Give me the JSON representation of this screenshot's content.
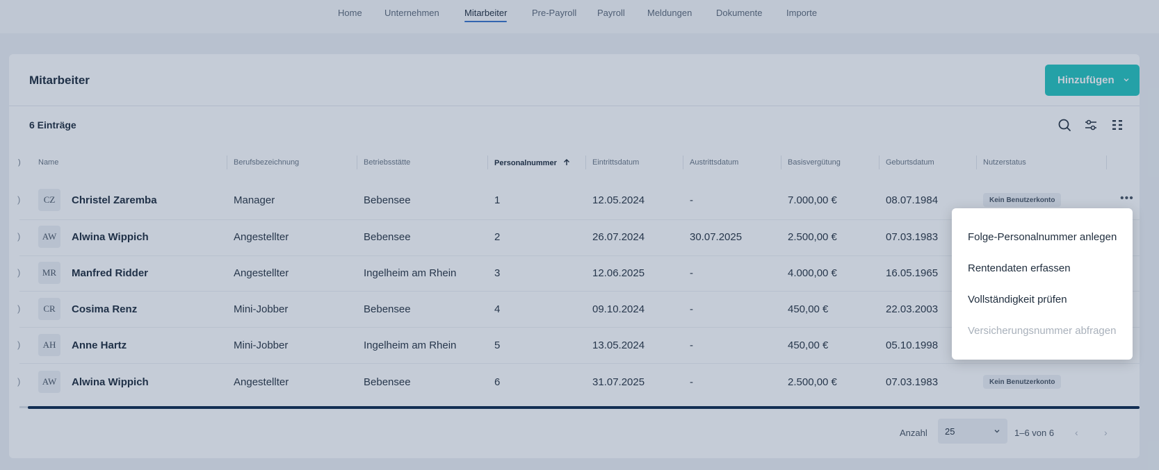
{
  "nav": {
    "tabs": [
      {
        "label": "Home"
      },
      {
        "label": "Unternehmen"
      },
      {
        "label": "Mitarbeiter",
        "active": true
      },
      {
        "label": "Pre-Payroll"
      },
      {
        "label": "Payroll"
      },
      {
        "label": "Meldungen"
      },
      {
        "label": "Dokumente"
      },
      {
        "label": "Importe"
      }
    ]
  },
  "card": {
    "title": "Mitarbeiter",
    "add_label": "Hinzufügen",
    "entries": "6 Einträge",
    "tools": [
      "search-icon",
      "filter-sliders-icon",
      "columns-icon"
    ]
  },
  "table": {
    "columns": [
      "Name",
      "Berufsbezeichnung",
      "Betriebsstätte",
      "Personalnummer",
      "Eintrittsdatum",
      "Austrittsdatum",
      "Basisvergütung",
      "Geburtsdatum",
      "Nutzerstatus"
    ],
    "sorted_column": "Personalnummer",
    "rows": [
      {
        "initials": "CZ",
        "name": "Christel Zaremba",
        "job": "Manager",
        "site": "Bebensee",
        "nr": "1",
        "entry": "12.05.2024",
        "exit": "-",
        "salary": "7.000,00 €",
        "birth": "08.07.1984",
        "status": "Kein Benutzerkonto"
      },
      {
        "initials": "AW",
        "name": "Alwina Wippich",
        "job": "Angestellter",
        "site": "Bebensee",
        "nr": "2",
        "entry": "26.07.2024",
        "exit": "30.07.2025",
        "salary": "2.500,00 €",
        "birth": "07.03.1983",
        "status": ""
      },
      {
        "initials": "MR",
        "name": "Manfred Ridder",
        "job": "Angestellter",
        "site": "Ingelheim am Rhein",
        "nr": "3",
        "entry": "12.06.2025",
        "exit": "-",
        "salary": "4.000,00 €",
        "birth": "16.05.1965",
        "status": ""
      },
      {
        "initials": "CR",
        "name": "Cosima Renz",
        "job": "Mini-Jobber",
        "site": "Bebensee",
        "nr": "4",
        "entry": "09.10.2024",
        "exit": "-",
        "salary": "450,00 €",
        "birth": "22.03.2003",
        "status": ""
      },
      {
        "initials": "AH",
        "name": "Anne Hartz",
        "job": "Mini-Jobber",
        "site": "Ingelheim am Rhein",
        "nr": "5",
        "entry": "13.05.2024",
        "exit": "-",
        "salary": "450,00 €",
        "birth": "05.10.1998",
        "status": ""
      },
      {
        "initials": "AW",
        "name": "Alwina Wippich",
        "job": "Angestellter",
        "site": "Bebensee",
        "nr": "6",
        "entry": "31.07.2025",
        "exit": "-",
        "salary": "2.500,00 €",
        "birth": "07.03.1983",
        "status": "Kein Benutzerkonto"
      }
    ]
  },
  "pagination": {
    "label": "Anzahl",
    "page_size": "25",
    "range": "1–6 von 6",
    "prev": "‹",
    "next": "›"
  },
  "menu": {
    "items": [
      {
        "label": "Folge-Personalnummer anlegen",
        "disabled": false
      },
      {
        "label": "Rentendaten erfassen",
        "disabled": false
      },
      {
        "label": "Vollständigkeit prüfen",
        "disabled": false
      },
      {
        "label": "Versicherungsnummer abfragen",
        "disabled": true
      }
    ]
  },
  "colors": {
    "accent": "#26c6be",
    "active_tab_underline": "#3a74c9",
    "scrollbar": "#0e2a4d",
    "overlay": "rgba(30, 58, 100, 0.26)"
  }
}
